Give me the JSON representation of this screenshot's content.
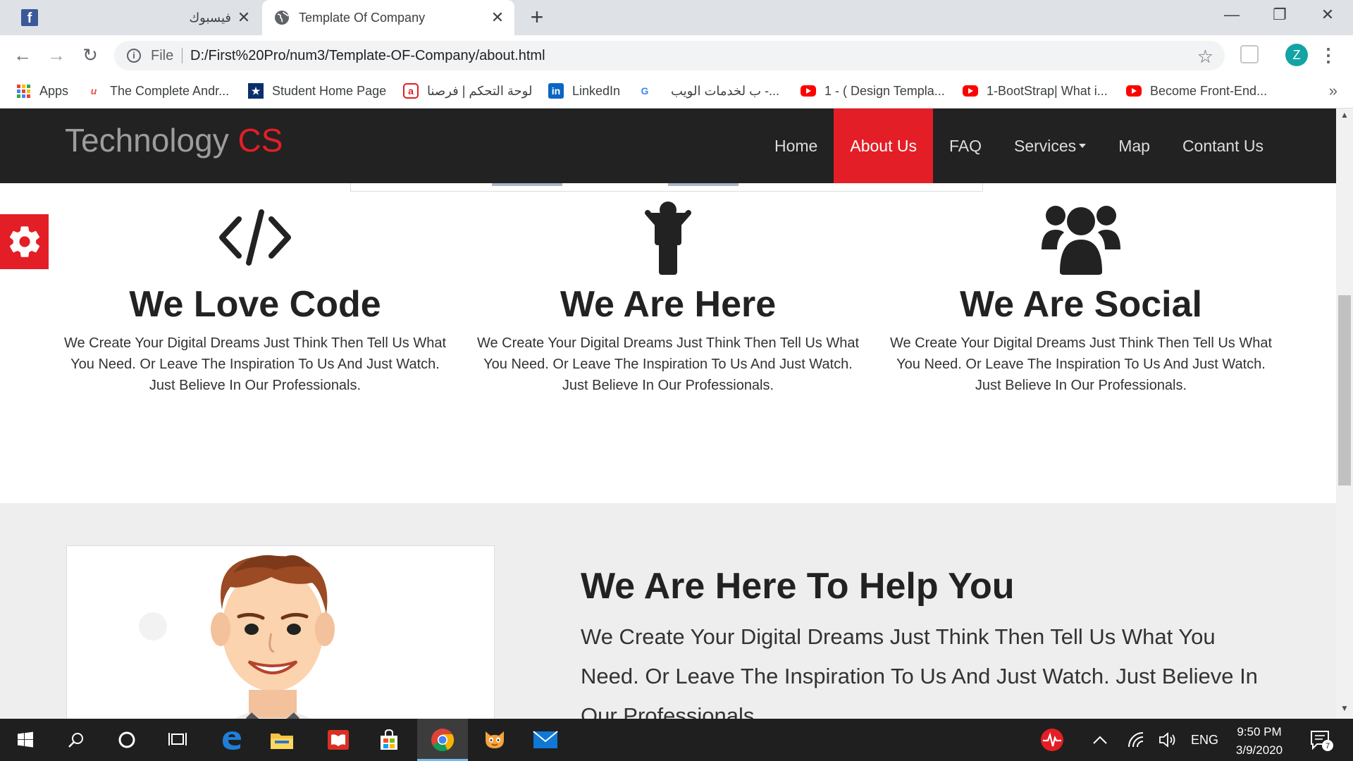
{
  "browser": {
    "tabs": [
      {
        "title": "فيسبوك",
        "icon": "facebook-icon",
        "active": false
      },
      {
        "title": "Template Of Company",
        "icon": "globe-icon",
        "active": true
      }
    ],
    "close_glyph": "✕",
    "new_tab_glyph": "+",
    "window_controls": {
      "minimize": "—",
      "restore": "❐",
      "close": "✕"
    },
    "url_scheme": "File",
    "url": "D:/First%20Pro/num3/Template-OF-Company/about.html",
    "profile_initial": "Z",
    "bookmarks": [
      {
        "label": "Apps",
        "icon": "apps-grid-icon"
      },
      {
        "label": "The Complete Andr...",
        "icon": "udemy-icon"
      },
      {
        "label": "Student Home Page",
        "icon": "star-badge-icon"
      },
      {
        "label": "لوحة التحكم | فرصنا",
        "icon": "forsa-icon"
      },
      {
        "label": "LinkedIn",
        "icon": "linkedin-icon"
      },
      {
        "label": "",
        "icon": "google-icon"
      },
      {
        "label": "ب لخدمات الويب -...",
        "icon": "none"
      },
      {
        "label": "1 - ( Design Templa...",
        "icon": "youtube-icon"
      },
      {
        "label": "1-BootStrap| What i...",
        "icon": "youtube-icon"
      },
      {
        "label": "Become Front-End...",
        "icon": "youtube-icon"
      }
    ],
    "bookmarks_more": "»"
  },
  "site": {
    "brand": {
      "main": "Technology ",
      "accent": "CS"
    },
    "menu": [
      {
        "label": "Home",
        "active": false
      },
      {
        "label": "About Us",
        "active": true
      },
      {
        "label": "FAQ",
        "active": false
      },
      {
        "label": "Services",
        "active": false,
        "dropdown": true
      },
      {
        "label": "Map",
        "active": false
      },
      {
        "label": "Contant Us",
        "active": false
      }
    ],
    "features": [
      {
        "icon": "code-icon",
        "title": "We Love Code",
        "text": "We Create Your Digital Dreams Just Think Then Tell Us What You Need. Or Leave The Inspiration To Us And Just Watch. Just Believe In Our Professionals."
      },
      {
        "icon": "child-icon",
        "title": "We Are Here",
        "text": "We Create Your Digital Dreams Just Think Then Tell Us What You Need. Or Leave The Inspiration To Us And Just Watch. Just Believe In Our Professionals."
      },
      {
        "icon": "users-icon",
        "title": "We Are Social",
        "text": "We Create Your Digital Dreams Just Think Then Tell Us What You Need. Or Leave The Inspiration To Us And Just Watch. Just Believe In Our Professionals."
      }
    ],
    "help": {
      "title": "We Are Here To Help You",
      "text": "We Create Your Digital Dreams Just Think Then Tell Us What You Need. Or Leave The Inspiration To Us And Just Watch. Just Believe In Our Professionals."
    },
    "colors": {
      "accent": "#e41e26",
      "nav_bg": "#222222",
      "section_gray": "#eeeeee"
    }
  },
  "taskbar": {
    "language": "ENG",
    "time": "9:50 PM",
    "date": "3/9/2020",
    "notification_count": "7",
    "apps": [
      "windows-start-icon",
      "search-icon",
      "cortana-icon",
      "task-view-icon",
      "edge-icon",
      "file-explorer-icon",
      "reader-icon",
      "store-icon",
      "chrome-icon",
      "scratch-icon",
      "mail-icon"
    ]
  }
}
